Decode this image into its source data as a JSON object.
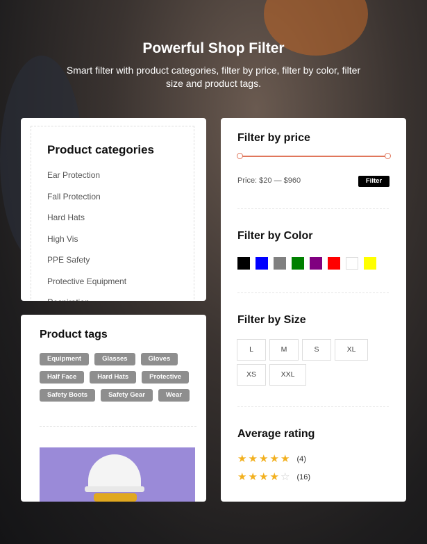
{
  "hero": {
    "title": "Powerful Shop Filter",
    "subtitle": "Smart filter with product categories, filter by price, filter by color, filter size and product tags."
  },
  "categories": {
    "title": "Product categories",
    "items": [
      "Ear Protection",
      "Fall Protection",
      "Hard Hats",
      "High Vis",
      "PPE Safety",
      "Protective Equipment",
      "Respiration"
    ]
  },
  "tags": {
    "title": "Product tags",
    "items": [
      "Equipment",
      "Glasses",
      "Gloves",
      "Half Face",
      "Hard Hats",
      "Protective",
      "Safety Boots",
      "Safety Gear",
      "Wear"
    ]
  },
  "price": {
    "title": "Filter by price",
    "label": "Price: $20 — $960",
    "min": 20,
    "max": 960,
    "button": "Filter",
    "accent": "#e0765b"
  },
  "color": {
    "title": "Filter by Color",
    "swatches": [
      "#000000",
      "#0000ff",
      "#808080",
      "#008000",
      "#800080",
      "#ff0000",
      "#ffffff",
      "#ffff00"
    ]
  },
  "size": {
    "title": "Filter by Size",
    "items": [
      "L",
      "M",
      "S",
      "XL",
      "XS",
      "XXL"
    ]
  },
  "rating": {
    "title": "Average rating",
    "rows": [
      {
        "stars": 5,
        "count": "(4)"
      },
      {
        "stars": 4,
        "count": "(16)"
      }
    ],
    "star_color": "#f2b01e"
  }
}
